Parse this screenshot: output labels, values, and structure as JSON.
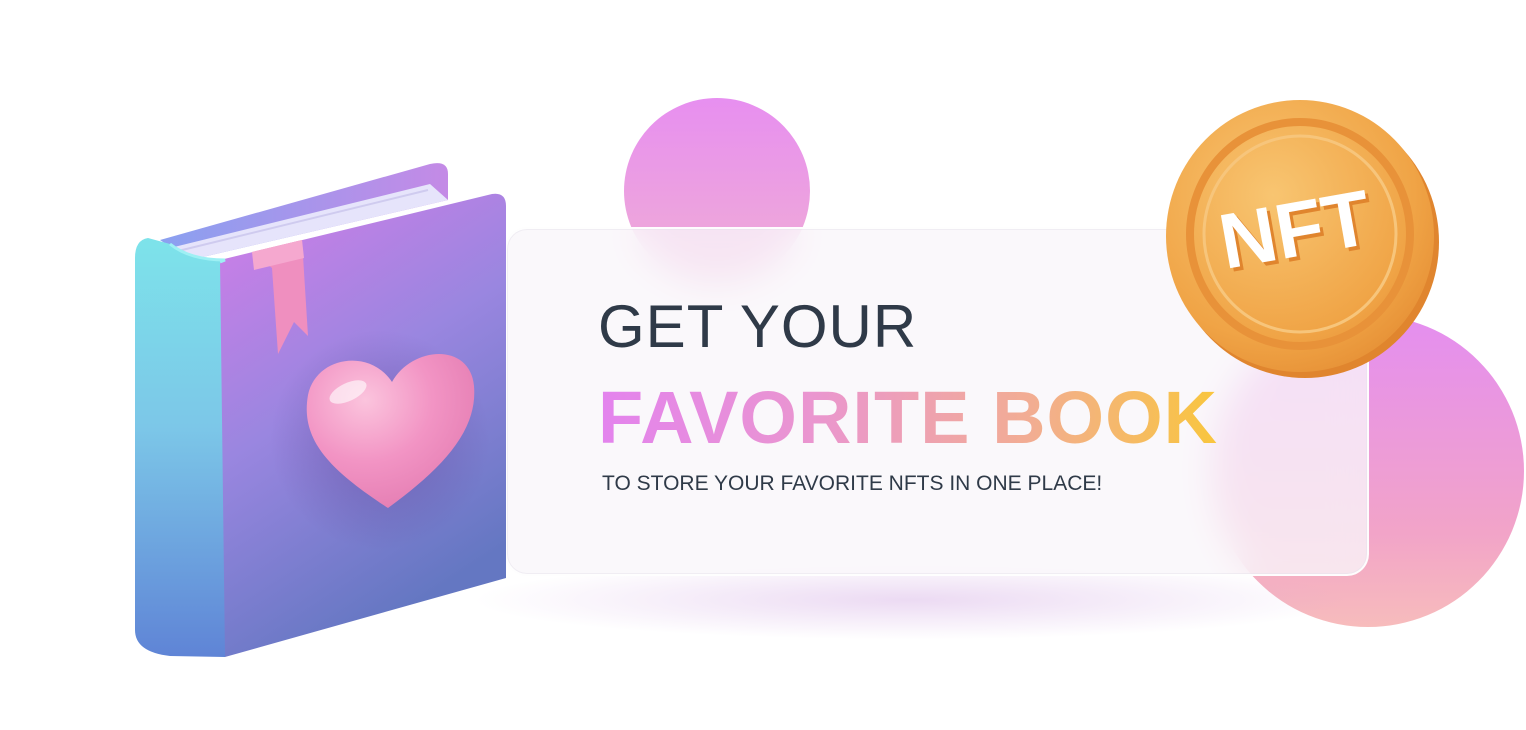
{
  "banner": {
    "headline_line1": "GET YOUR",
    "headline_line2": "FAVORITE BOOK",
    "subtitle": "TO STORE YOUR FAVORITE NFTS IN ONE PLACE!"
  },
  "coin": {
    "label": "NFT",
    "icon": "nft-coin-icon",
    "color": "#f2a640"
  },
  "book": {
    "icon": "book-with-heart-icon",
    "cover_color_top": "#c478e6",
    "cover_color_bottom": "#6a78c8",
    "heart_color": "#f28cbf"
  },
  "colors": {
    "text_dark": "#2f3a48",
    "gradient_start": "#e383ee",
    "gradient_end": "#f9c63d"
  }
}
